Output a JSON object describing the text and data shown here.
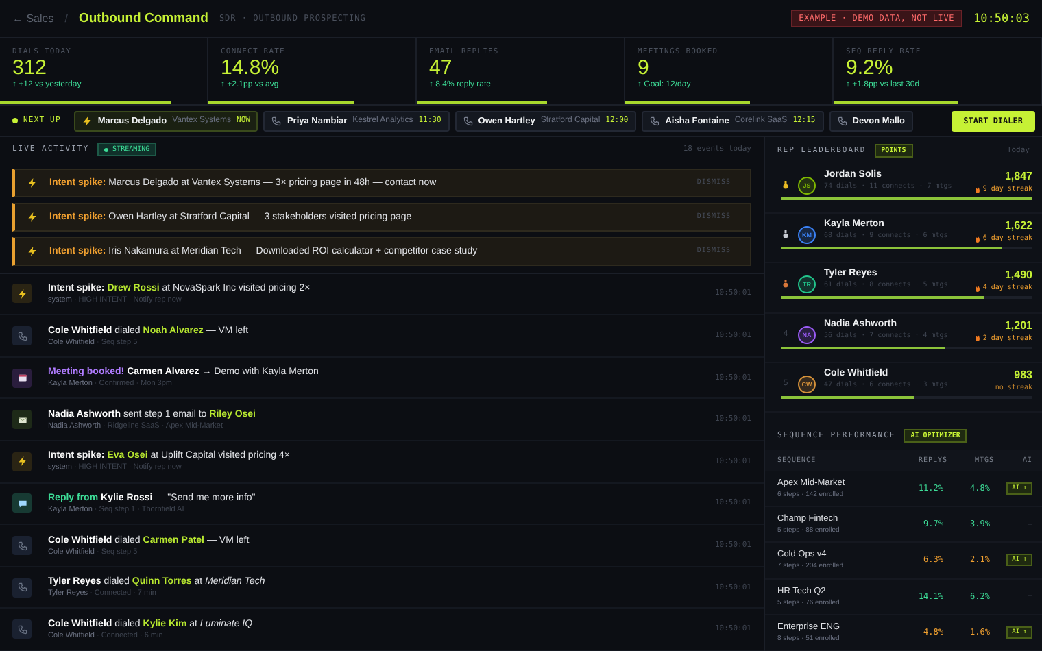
{
  "header": {
    "back": "← Sales",
    "separator": "/",
    "title": "Outbound Command",
    "subtitle": "SDR · OUTBOUND PROSPECTING",
    "badge": "EXAMPLE · DEMO DATA, NOT LIVE",
    "clock": "10:50:03"
  },
  "stats": [
    {
      "label": "DIALS TODAY",
      "value": "312",
      "delta": "↑ +12 vs yesterday",
      "level": 0.83
    },
    {
      "label": "CONNECT RATE",
      "value": "14.8%",
      "delta": "↑ +2.1pp vs avg",
      "level": 0.7
    },
    {
      "label": "EMAIL REPLIES",
      "value": "47",
      "delta": "↑ 8.4% reply rate",
      "level": 0.63
    },
    {
      "label": "MEETINGS BOOKED",
      "value": "9",
      "delta": "↑ Goal: 12/day",
      "level": 0.6
    },
    {
      "label": "SEQ REPLY RATE",
      "value": "9.2%",
      "delta": "↑ +1.8pp vs last 30d",
      "level": 0.6
    }
  ],
  "next_up": {
    "label": "NEXT UP",
    "items": [
      {
        "kind": "now",
        "name": "Marcus Delgado",
        "company": "Vantex Systems",
        "time": "NOW"
      },
      {
        "kind": "scheduled",
        "name": "Priya Nambiar",
        "company": "Kestrel Analytics",
        "time": "11:30"
      },
      {
        "kind": "scheduled",
        "name": "Owen Hartley",
        "company": "Stratford Capital",
        "time": "12:00"
      },
      {
        "kind": "scheduled",
        "name": "Aisha Fontaine",
        "company": "Corelink SaaS",
        "time": "12:15"
      },
      {
        "kind": "scheduled",
        "name": "Devon Mallo"
      }
    ],
    "button": "START DIALER"
  },
  "live_activity": {
    "title": "LIVE ACTIVITY",
    "badge": "STREAMING",
    "count": "18 events today",
    "alerts": [
      {
        "label": "Intent spike:",
        "text": "Marcus Delgado at Vantex Systems — 3× pricing page in 48h — contact now",
        "action": "DISMISS"
      },
      {
        "label": "Intent spike:",
        "text": "Owen Hartley at Stratford Capital — 3 stakeholders visited pricing page",
        "action": "DISMISS"
      },
      {
        "label": "Intent spike:",
        "text": "Iris Nakamura at Meridian Tech — Downloaded ROI calculator + competitor case study",
        "action": "DISMISS"
      }
    ],
    "events": [
      {
        "kind": "intent",
        "parts": [
          {
            "kind": "label",
            "text": "Intent spike:"
          },
          {
            "kind": "lead",
            "text": "Drew Rossi"
          },
          {
            "kind": "text",
            "text": "at NovaSpark Inc visited pricing 2×"
          }
        ],
        "author": "system",
        "detail": "· HIGH INTENT · Notify rep now",
        "time": "10:50:01"
      },
      {
        "kind": "call",
        "parts": [
          {
            "kind": "actor",
            "text": "Cole Whitfield"
          },
          {
            "kind": "text",
            "text": "dialed"
          },
          {
            "kind": "lead",
            "text": "Noah Alvarez"
          },
          {
            "kind": "text",
            "text": "— VM left"
          }
        ],
        "author": "Cole Whitfield",
        "detail": "· Seq step 5",
        "time": "10:50:01"
      },
      {
        "kind": "meeting",
        "parts": [
          {
            "kind": "label",
            "text": "Meeting booked!"
          },
          {
            "kind": "actor",
            "text": "Carmen Alvarez"
          },
          {
            "kind": "text",
            "text": "→ Demo with Kayla Merton"
          }
        ],
        "author": "Kayla Merton",
        "detail": "· Confirmed · Mon 3pm",
        "time": "10:50:01"
      },
      {
        "kind": "email",
        "parts": [
          {
            "kind": "actor",
            "text": "Nadia Ashworth"
          },
          {
            "kind": "text",
            "text": "sent step 1 email to"
          },
          {
            "kind": "lead",
            "text": "Riley Osei"
          }
        ],
        "author": "Nadia Ashworth",
        "detail": "· Ridgeline SaaS · Apex Mid-Market",
        "time": "10:50:01"
      },
      {
        "kind": "intent",
        "parts": [
          {
            "kind": "label",
            "text": "Intent spike:"
          },
          {
            "kind": "lead",
            "text": "Eva Osei"
          },
          {
            "kind": "text",
            "text": "at Uplift Capital visited pricing 4×"
          }
        ],
        "author": "system",
        "detail": "· HIGH INTENT · Notify rep now",
        "time": "10:50:01"
      },
      {
        "kind": "reply",
        "parts": [
          {
            "kind": "label",
            "text": "Reply from"
          },
          {
            "kind": "actor",
            "text": "Kylie Rossi"
          },
          {
            "kind": "text",
            "text": "— \"Send me more info\""
          }
        ],
        "author": "Kayla Merton",
        "detail": "· Seq step 1 · Thornfield AI",
        "time": "10:50:01"
      },
      {
        "kind": "call",
        "parts": [
          {
            "kind": "actor",
            "text": "Cole Whitfield"
          },
          {
            "kind": "text",
            "text": "dialed"
          },
          {
            "kind": "lead",
            "text": "Carmen Patel"
          },
          {
            "kind": "text",
            "text": "— VM left"
          }
        ],
        "author": "Cole Whitfield",
        "detail": "· Seq step 5",
        "time": "10:50:01"
      },
      {
        "kind": "call",
        "parts": [
          {
            "kind": "actor",
            "text": "Tyler Reyes"
          },
          {
            "kind": "text",
            "text": "dialed"
          },
          {
            "kind": "lead",
            "text": "Quinn Torres"
          },
          {
            "kind": "text",
            "text": "at"
          },
          {
            "kind": "company",
            "text": "Meridian Tech"
          }
        ],
        "author": "Tyler Reyes",
        "detail": "· Connected · 7 min",
        "time": "10:50:01"
      },
      {
        "kind": "call",
        "parts": [
          {
            "kind": "actor",
            "text": "Cole Whitfield"
          },
          {
            "kind": "text",
            "text": "dialed"
          },
          {
            "kind": "lead",
            "text": "Kylie Kim"
          },
          {
            "kind": "text",
            "text": "at"
          },
          {
            "kind": "company",
            "text": "Luminate IQ"
          }
        ],
        "author": "Cole Whitfield",
        "detail": "· Connected · 6 min",
        "time": "10:50:01"
      }
    ]
  },
  "leaderboard": {
    "title": "REP LEADERBOARD",
    "badge": "POINTS",
    "period": "Today",
    "reps": [
      {
        "kind": "medal",
        "medal": {
          "color": "#e8b923"
        },
        "initials": "JS",
        "color": "#7fb800",
        "name": "Jordan Solis",
        "stats": "74 dials · 11 connects · 7 mtgs",
        "points": "1,847",
        "streak": "9 day streak",
        "streak_active": true,
        "level": 1.0
      },
      {
        "kind": "medal",
        "medal": {
          "color": "#c8ccd4"
        },
        "initials": "KM",
        "color": "#3b82f6",
        "name": "Kayla Merton",
        "stats": "68 dials · 9 connects · 6 mtgs",
        "points": "1,622",
        "streak": "6 day streak",
        "streak_active": true,
        "level": 0.88
      },
      {
        "kind": "medal",
        "medal": {
          "color": "#d9773a"
        },
        "initials": "TR",
        "color": "#22c58b",
        "name": "Tyler Reyes",
        "stats": "61 dials · 8 connects · 5 mtgs",
        "points": "1,490",
        "streak": "4 day streak",
        "streak_active": true,
        "level": 0.81
      },
      {
        "kind": "number",
        "rank": "4",
        "initials": "NA",
        "color": "#9b5cf6",
        "name": "Nadia Ashworth",
        "stats": "56 dials · 7 connects · 4 mtgs",
        "points": "1,201",
        "streak": "2 day streak",
        "streak_active": true,
        "level": 0.65
      },
      {
        "kind": "number",
        "rank": "5",
        "initials": "CW",
        "color": "#d4913a",
        "name": "Cole Whitfield",
        "stats": "47 dials · 6 connects · 3 mtgs",
        "points": "983",
        "streak": "no streak",
        "streak_active": false,
        "level": 0.53
      }
    ]
  },
  "sequences": {
    "title": "SEQUENCE PERFORMANCE",
    "badge": "AI OPTIMIZER",
    "columns": [
      "SEQUENCE",
      "REPLYS",
      "MTGS",
      "AI"
    ],
    "rows": [
      {
        "name": "Apex Mid-Market",
        "sub": "6 steps · 142 enrolled",
        "replies": "11.2%",
        "mtgs": "4.8%",
        "below_target": false,
        "ai_suggested": true,
        "ai": "AI ↑"
      },
      {
        "name": "Champ Fintech",
        "sub": "5 steps · 88 enrolled",
        "replies": "9.7%",
        "mtgs": "3.9%",
        "below_target": false,
        "ai_suggested": false,
        "ai": "–"
      },
      {
        "name": "Cold Ops v4",
        "sub": "7 steps · 204 enrolled",
        "replies": "6.3%",
        "mtgs": "2.1%",
        "below_target": true,
        "ai_suggested": true,
        "ai": "AI ↑"
      },
      {
        "name": "HR Tech Q2",
        "sub": "5 steps · 76 enrolled",
        "replies": "14.1%",
        "mtgs": "6.2%",
        "below_target": false,
        "ai_suggested": false,
        "ai": "–"
      },
      {
        "name": "Enterprise ENG",
        "sub": "8 steps · 51 enrolled",
        "replies": "4.8%",
        "mtgs": "1.6%",
        "below_target": true,
        "ai_suggested": true,
        "ai": "AI ↑"
      }
    ]
  }
}
